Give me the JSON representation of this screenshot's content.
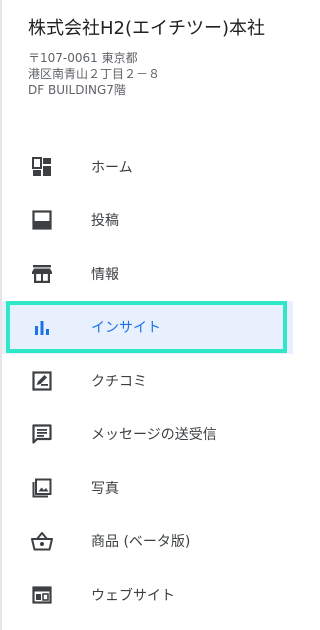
{
  "business": {
    "name": "株式会社H2(エイチツー)本社",
    "address_line1": "〒107-0061 東京都",
    "address_line2": "港区南青山２丁目２－８",
    "address_line3": "DF BUILDING7階"
  },
  "nav": {
    "items": [
      {
        "label": "ホーム",
        "icon": "dashboard-icon"
      },
      {
        "label": "投稿",
        "icon": "posts-icon"
      },
      {
        "label": "情報",
        "icon": "store-icon"
      },
      {
        "label": "インサイト",
        "icon": "bar-chart-icon",
        "active": true
      },
      {
        "label": "クチコミ",
        "icon": "review-icon"
      },
      {
        "label": "メッセージの送受信",
        "icon": "message-icon"
      },
      {
        "label": "写真",
        "icon": "photo-icon"
      },
      {
        "label": "商品 (ベータ版)",
        "icon": "basket-icon"
      },
      {
        "label": "ウェブサイト",
        "icon": "website-icon"
      }
    ]
  },
  "colors": {
    "active_bg": "#e8f0fe",
    "active_text": "#1a73e8",
    "highlight": "#2ee8c8",
    "icon": "#3c4043"
  }
}
